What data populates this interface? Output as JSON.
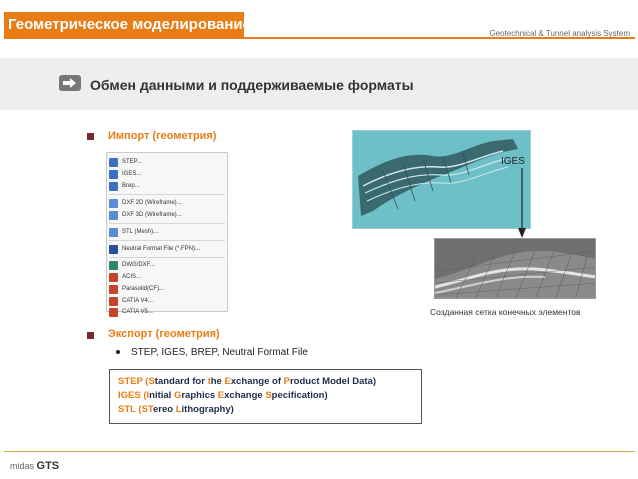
{
  "header": {
    "title": "Геометрическое моделирование",
    "subtitle": "Geotechnical & Tunnel analysis System"
  },
  "section": {
    "title": "Обмен данными и поддерживаемые форматы",
    "icon": "arrow-right-icon"
  },
  "import": {
    "title": "Импорт (геометрия)",
    "menu": [
      {
        "label": "STEP...",
        "icon": "step-icon",
        "color": "#3a6fc4"
      },
      {
        "label": "IGES...",
        "icon": "iges-icon",
        "color": "#3a6fc4"
      },
      {
        "label": "Brep...",
        "icon": "brep-icon",
        "color": "#3a6fc4"
      },
      {
        "label": "DXF 2D (Wireframe)...",
        "icon": "dxf2d-icon",
        "color": "#5b8bd6"
      },
      {
        "label": "DXF 3D (Wireframe)...",
        "icon": "dxf3d-icon",
        "color": "#5b8bd6"
      },
      {
        "label": "STL (Mesh)...",
        "icon": "stl-icon",
        "color": "#5b8bd6"
      },
      {
        "label": "Neutral Format File (*.FPN)...",
        "icon": "fpn-icon",
        "color": "#2a4f9a"
      },
      {
        "label": "DWG/DXF...",
        "icon": "dwg-icon",
        "color": "#2a8a6a"
      },
      {
        "label": "ACIS...",
        "icon": "acis-icon",
        "color": "#c4452a"
      },
      {
        "label": "Parasolid(CF)...",
        "icon": "parasolid-icon",
        "color": "#c4452a"
      },
      {
        "label": "CATIA V4...",
        "icon": "catia4-icon",
        "color": "#c4452a"
      },
      {
        "label": "CATIA V5...",
        "icon": "catia5-icon",
        "color": "#c4452a"
      }
    ]
  },
  "iges_label": "IGES",
  "mesh_caption": "Созданная сетка конечных элементов",
  "export": {
    "title": "Экспорт (геометрия)",
    "item": "STEP, IGES, BREP, Neutral Format File"
  },
  "definitions": {
    "step": {
      "a": "STEP (",
      "b": "S",
      "c": "tandard for ",
      "d": "t",
      "e": "he ",
      "f": "E",
      "g": "xchange of ",
      "h": "P",
      "i": "roduct Model Data)"
    },
    "iges": {
      "a": "IGES (",
      "b": "I",
      "c": "nitial ",
      "d": "G",
      "e": "raphics ",
      "f": "E",
      "g": "xchange ",
      "h": "S",
      "i": "pecification)"
    },
    "stl": {
      "a": "STL (",
      "b": "ST",
      "c": "ereo ",
      "d": "L",
      "e": "ithography)"
    }
  },
  "footer": {
    "brand_small": "midas",
    "brand_big": "GTS"
  },
  "colors": {
    "accent": "#e87d16",
    "text_dark": "#1f2d4a",
    "bullet": "#7a2a2a"
  }
}
